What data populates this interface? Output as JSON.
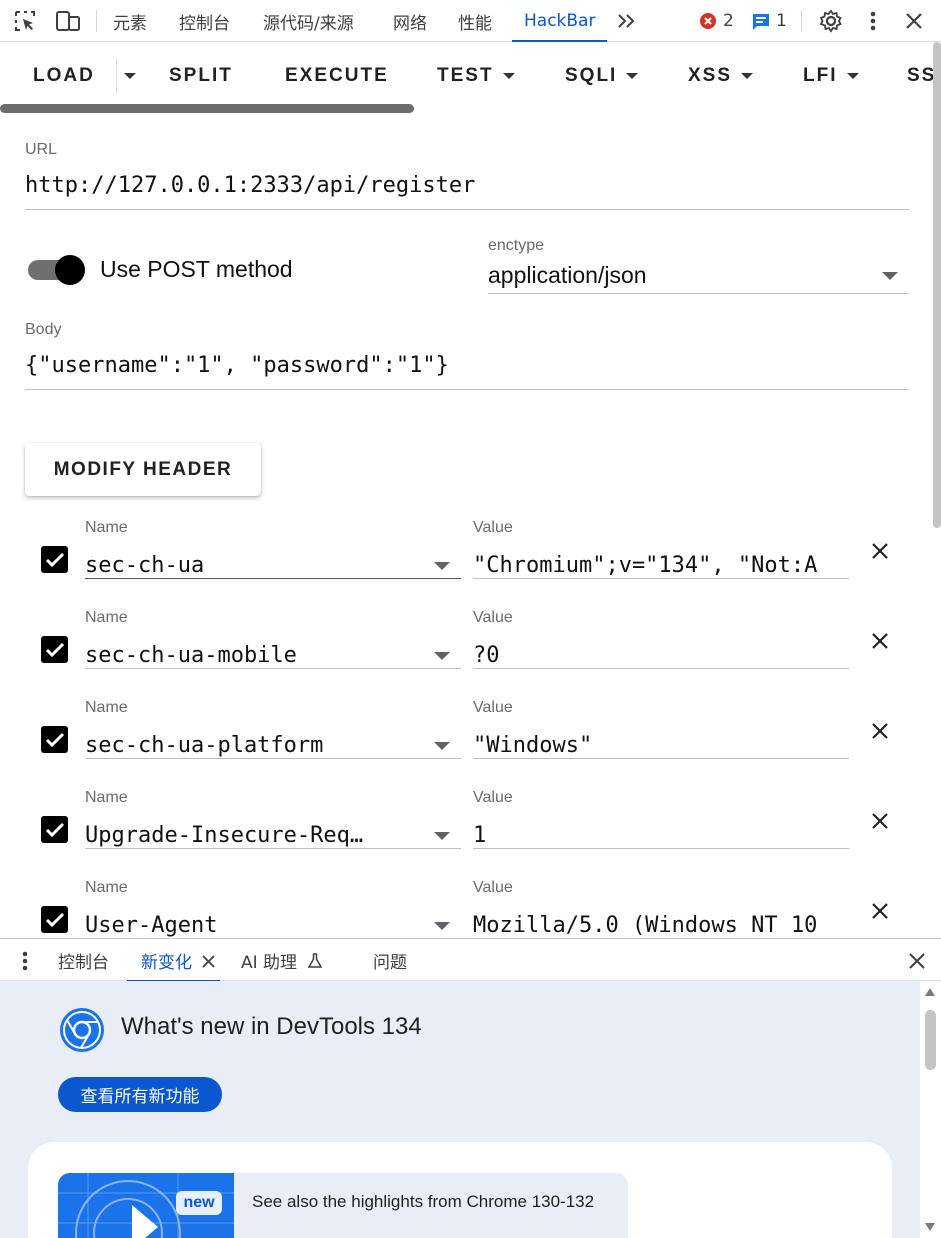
{
  "devtools": {
    "tabs": [
      {
        "label": "元素"
      },
      {
        "label": "控制台"
      },
      {
        "label": "源代码/来源"
      },
      {
        "label": "网络"
      },
      {
        "label": "性能"
      },
      {
        "label": "HackBar"
      }
    ],
    "active_tab": "HackBar",
    "error_count": "2",
    "message_count": "1"
  },
  "hackbar": {
    "toolbar": {
      "load": "LOAD",
      "split": "SPLIT",
      "execute": "EXECUTE",
      "test": "TEST",
      "sqli": "SQLI",
      "xss": "XSS",
      "lfi": "LFI",
      "ssti": "SS"
    },
    "url_label": "URL",
    "url": "http://127.0.0.1:2333/api/register",
    "post_toggle_label": "Use POST method",
    "post_enabled": true,
    "enctype_label": "enctype",
    "enctype": "application/json",
    "body_label": "Body",
    "body": "{\"username\":\"1\", \"password\":\"1\"}",
    "modify_header_label": "MODIFY HEADER",
    "headers": [
      {
        "enabled": true,
        "name_label": "Name",
        "name": "sec-ch-ua",
        "value_label": "Value",
        "value": "\"Chromium\";v=\"134\", \"Not:A"
      },
      {
        "enabled": true,
        "name_label": "Name",
        "name": "sec-ch-ua-mobile",
        "value_label": "Value",
        "value": "?0"
      },
      {
        "enabled": true,
        "name_label": "Name",
        "name": "sec-ch-ua-platform",
        "value_label": "Value",
        "value": "\"Windows\""
      },
      {
        "enabled": true,
        "name_label": "Name",
        "name": "Upgrade-Insecure-Req…",
        "value_label": "Value",
        "value": "1"
      },
      {
        "enabled": true,
        "name_label": "Name",
        "name": "User-Agent",
        "value_label": "Value",
        "value": "Mozilla/5.0 (Windows NT 10"
      }
    ]
  },
  "drawer": {
    "tabs": [
      {
        "label": "控制台"
      },
      {
        "label": "新变化"
      },
      {
        "label": "AI 助理"
      },
      {
        "label": "问题"
      }
    ],
    "active_tab": "新变化",
    "whats_new_title": "What's new in DevTools 134",
    "see_all_button": "查看所有新功能",
    "card_badge": "new",
    "card_text": "See also the highlights from Chrome 130-132"
  },
  "colors": {
    "accent": "#0b57d0",
    "drawer_bg": "#e9eef6",
    "error_red": "#d93025"
  }
}
